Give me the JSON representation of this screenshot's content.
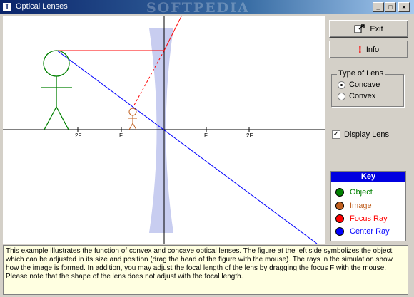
{
  "window": {
    "title": "Optical Lenses",
    "watermark": "SOFTPEDIA",
    "controls": {
      "minimize": "_",
      "maximize": "□",
      "close": "×"
    }
  },
  "sidebar": {
    "exit_label": "Exit",
    "info_label": "Info",
    "lens_type": {
      "legend": "Type of Lens",
      "options": [
        "Concave",
        "Convex"
      ],
      "selected": "Concave"
    },
    "display_lens_label": "Display Lens",
    "display_lens_checked": true
  },
  "key": {
    "title": "Key",
    "items": [
      {
        "label": "Object",
        "color": "#008000",
        "text_color": "#008000"
      },
      {
        "label": "Image",
        "color": "#c06020",
        "text_color": "#c06020"
      },
      {
        "label": "Focus Ray",
        "color": "#ff0000",
        "text_color": "#ff0000"
      },
      {
        "label": "Center Ray",
        "color": "#0000ff",
        "text_color": "#0000ff"
      }
    ]
  },
  "axis_labels": {
    "left_2f": "2F",
    "left_f": "F",
    "right_f": "F",
    "right_2f": "2F"
  },
  "description": "This example illustrates the function of convex and concave optical lenses. The figure at the left side symbolizes the object which can be adjusted in its size and position (drag the head of the figure with the mouse). The rays in the simulation show how the image is formed. In addition, you may adjust the focal length of the lens by dragging the focus F with the mouse. Please note that the shape of the lens does not adjust with the focal length.",
  "colors": {
    "object": "#008000",
    "image": "#c06020",
    "focus_ray": "#ff0000",
    "center_ray": "#0000ff",
    "lens": "#c8cdf0",
    "titlebar": "#0a246a"
  },
  "icons": {
    "exit": "exit-icon",
    "info": "exclamation-icon",
    "app": "app-icon"
  }
}
